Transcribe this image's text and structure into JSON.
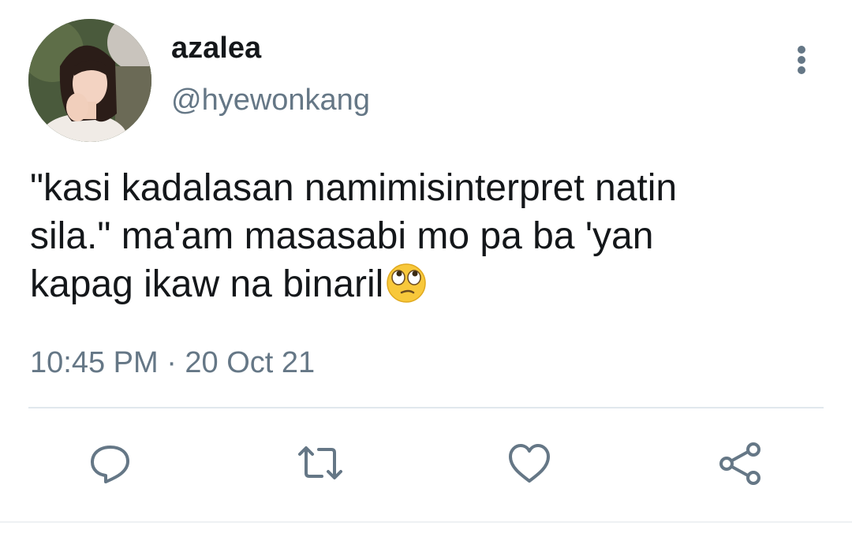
{
  "author": {
    "display_name": "azalea",
    "handle": "@hyewonkang",
    "avatar_icon": "profile-photo"
  },
  "tweet": {
    "text_lines": [
      "\"kasi kadalasan namimisinterpret natin",
      "sila.\" ma'am masasabi mo pa ba 'yan",
      "kapag ikaw na binaril"
    ],
    "emoji": "face-with-rolling-eyes",
    "timestamp": "10:45 PM · 20 Oct 21"
  },
  "actions": [
    {
      "name": "reply",
      "icon": "speech-bubble-icon"
    },
    {
      "name": "retweet",
      "icon": "retweet-icon"
    },
    {
      "name": "like",
      "icon": "heart-icon"
    },
    {
      "name": "share",
      "icon": "share-icon"
    }
  ],
  "menu_icon": "more-vertical-icon",
  "colors": {
    "text": "#14171a",
    "secondary": "#657786",
    "divider": "#e1e8ed"
  }
}
